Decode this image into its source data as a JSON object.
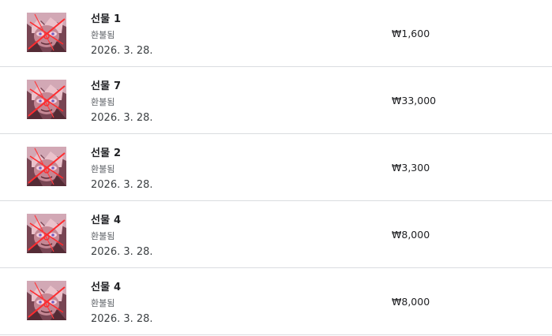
{
  "purchases": [
    {
      "title": "선물 1",
      "status": "환불됨",
      "date": "2026. 3. 28.",
      "price": "₩1,600",
      "thumbnail_icon": "artwork-thumbnail"
    },
    {
      "title": "선물 7",
      "status": "환불됨",
      "date": "2026. 3. 28.",
      "price": "₩33,000",
      "thumbnail_icon": "artwork-thumbnail"
    },
    {
      "title": "선물 2",
      "status": "환불됨",
      "date": "2026. 3. 28.",
      "price": "₩3,300",
      "thumbnail_icon": "artwork-thumbnail"
    },
    {
      "title": "선물 4",
      "status": "환불됨",
      "date": "2026. 3. 28.",
      "price": "₩8,000",
      "thumbnail_icon": "artwork-thumbnail"
    },
    {
      "title": "선물 4",
      "status": "환불됨",
      "date": "2026. 3. 28.",
      "price": "₩8,000",
      "thumbnail_icon": "artwork-thumbnail"
    }
  ],
  "colors": {
    "divider": "#dadce0",
    "title": "#202124",
    "status": "#5f6368"
  }
}
